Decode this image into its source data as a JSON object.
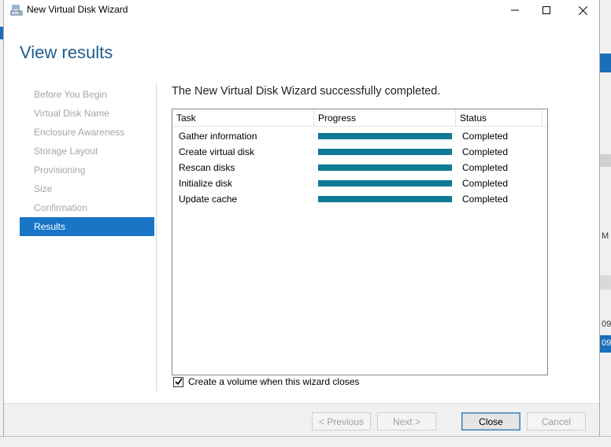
{
  "window": {
    "title": "New Virtual Disk Wizard"
  },
  "page": {
    "title": "View results",
    "headline": "The New Virtual Disk Wizard successfully completed."
  },
  "sidebar": {
    "items": [
      {
        "label": "Before You Begin"
      },
      {
        "label": "Virtual Disk Name"
      },
      {
        "label": "Enclosure Awareness"
      },
      {
        "label": "Storage Layout"
      },
      {
        "label": "Provisioning"
      },
      {
        "label": "Size"
      },
      {
        "label": "Confirmation"
      },
      {
        "label": "Results"
      }
    ],
    "active": "Results"
  },
  "table": {
    "columns": [
      "Task",
      "Progress",
      "Status"
    ],
    "rows": [
      {
        "task": "Gather information",
        "progress": 1.0,
        "status": "Completed"
      },
      {
        "task": "Create virtual disk",
        "progress": 1.0,
        "status": "Completed"
      },
      {
        "task": "Rescan disks",
        "progress": 1.0,
        "status": "Completed"
      },
      {
        "task": "Initialize disk",
        "progress": 1.0,
        "status": "Completed"
      },
      {
        "task": "Update cache",
        "progress": 1.0,
        "status": "Completed"
      }
    ]
  },
  "options": {
    "create_volume_label": "Create a volume when this wizard closes",
    "create_volume_checked": true
  },
  "buttons": {
    "previous": "< Previous",
    "next": "Next >",
    "close": "Close",
    "cancel": "Cancel"
  },
  "background": {
    "right_text_1": "M",
    "right_text_2": "09",
    "right_text_3": "09"
  },
  "colors": {
    "accent": "#1975c6",
    "title": "#1e5d8c",
    "progress": "#0e7a94"
  },
  "icons": {
    "window": "disk-wizard-icon",
    "minimize": "minimize-icon",
    "maximize": "maximize-icon",
    "close": "close-icon",
    "checkbox": "checkmark-icon"
  }
}
